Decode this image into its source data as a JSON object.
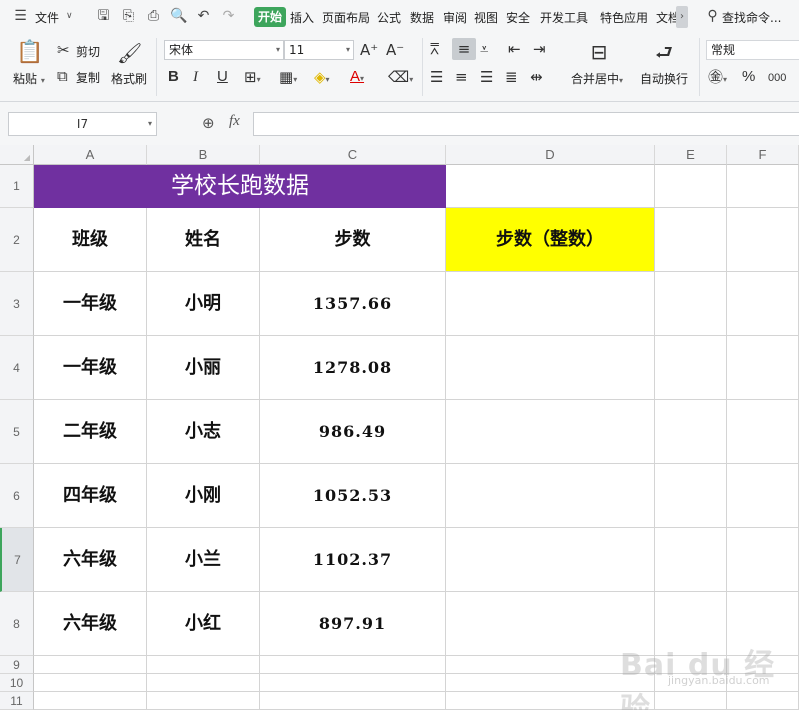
{
  "menu": {
    "file_label": "文件",
    "tabs": [
      "开始",
      "插入",
      "页面布局",
      "公式",
      "数据",
      "审阅",
      "视图",
      "安全",
      "开发工具",
      "特色应用",
      "文档"
    ],
    "search_label": "查找命令..."
  },
  "ribbon": {
    "paste": "粘贴",
    "cut": "剪切",
    "copy": "复制",
    "format_painter": "格式刷",
    "font_name": "宋体",
    "font_size": "11",
    "merge_center": "合并居中",
    "wrap_text": "自动换行",
    "number_format": "常规",
    "bold": "B",
    "italic": "I",
    "underline": "U",
    "font_color": "A",
    "grow_font": "A⁺",
    "shrink_font": "A⁻",
    "percent": "%",
    "thousands": "000"
  },
  "formula_bar": {
    "name_box": "I7",
    "fx": "fx",
    "value": ""
  },
  "sheet": {
    "columns": [
      "A",
      "B",
      "C",
      "D",
      "E",
      "F"
    ],
    "rows": [
      "1",
      "2",
      "3",
      "4",
      "5",
      "6",
      "7",
      "8",
      "9",
      "10",
      "11"
    ],
    "active_row": "7",
    "title": "学校长跑数据",
    "headers": [
      "班级",
      "姓名",
      "步数",
      "步数（整数）"
    ],
    "data": [
      {
        "class": "一年级",
        "name": "小明",
        "steps": "1357.66"
      },
      {
        "class": "一年级",
        "name": "小丽",
        "steps": "1278.08"
      },
      {
        "class": "二年级",
        "name": "小志",
        "steps": "986.49"
      },
      {
        "class": "四年级",
        "name": "小刚",
        "steps": "1052.53"
      },
      {
        "class": "六年级",
        "name": "小兰",
        "steps": "1102.37"
      },
      {
        "class": "六年级",
        "name": "小红",
        "steps": "897.91"
      }
    ]
  },
  "colors": {
    "title_fill": "#7030a0",
    "highlight_fill": "#ffff00",
    "active_tab": "#3da55c"
  },
  "watermark": {
    "main": "Bai du 经验",
    "sub": "jingyan.baidu.com"
  }
}
